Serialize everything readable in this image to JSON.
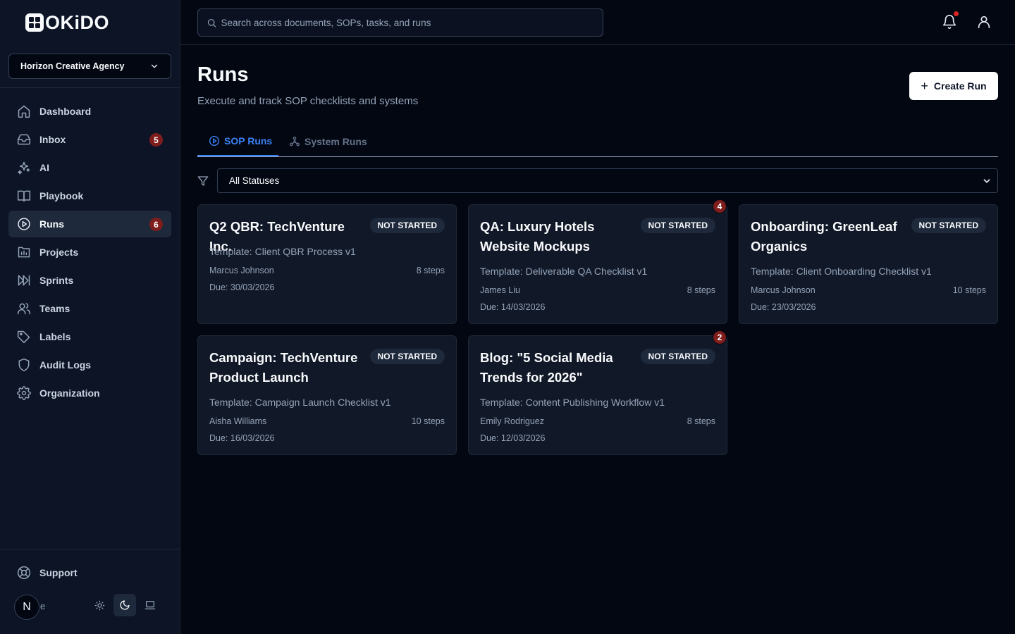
{
  "brand": {
    "name": "OKiDO"
  },
  "org": {
    "name": "Horizon Creative Agency"
  },
  "nav": {
    "items": [
      {
        "label": "Dashboard",
        "icon": "home-icon"
      },
      {
        "label": "Inbox",
        "icon": "inbox-icon",
        "badge": "5"
      },
      {
        "label": "AI",
        "icon": "sparkles-icon"
      },
      {
        "label": "Playbook",
        "icon": "book-icon"
      },
      {
        "label": "Runs",
        "icon": "play-circle-icon",
        "badge": "6",
        "active": true
      },
      {
        "label": "Projects",
        "icon": "chart-folder-icon"
      },
      {
        "label": "Sprints",
        "icon": "sprint-icon"
      },
      {
        "label": "Teams",
        "icon": "users-icon"
      },
      {
        "label": "Labels",
        "icon": "tag-icon"
      },
      {
        "label": "Audit Logs",
        "icon": "shield-icon"
      },
      {
        "label": "Organization",
        "icon": "gear-icon"
      }
    ],
    "support_label": "Support"
  },
  "user": {
    "initial": "N",
    "partial_text": "e"
  },
  "search": {
    "placeholder": "Search across documents, SOPs, tasks, and runs"
  },
  "page": {
    "title": "Runs",
    "subtitle": "Execute and track SOP checklists and systems",
    "create_label": "Create Run"
  },
  "tabs": [
    {
      "label": "SOP Runs",
      "active": true
    },
    {
      "label": "System Runs",
      "active": false
    }
  ],
  "filter": {
    "selected": "All Statuses"
  },
  "runs": [
    {
      "title": "Q2 QBR: TechVenture Inc.",
      "status": "NOT STARTED",
      "template": "Template: Client QBR Process v1",
      "assignee": "Marcus Johnson",
      "steps": "8 steps",
      "due": "Due: 30/03/2026"
    },
    {
      "title": "QA: Luxury Hotels Website Mockups",
      "status": "NOT STARTED",
      "template": "Template: Deliverable QA Checklist v1",
      "assignee": "James Liu",
      "steps": "8 steps",
      "due": "Due: 14/03/2026",
      "badge": "4"
    },
    {
      "title": "Onboarding: GreenLeaf Organics",
      "status": "NOT STARTED",
      "template": "Template: Client Onboarding Checklist v1",
      "assignee": "Marcus Johnson",
      "steps": "10 steps",
      "due": "Due: 23/03/2026"
    },
    {
      "title": "Campaign: TechVenture Product Launch",
      "status": "NOT STARTED",
      "template": "Template: Campaign Launch Checklist v1",
      "assignee": "Aisha Williams",
      "steps": "10 steps",
      "due": "Due: 16/03/2026"
    },
    {
      "title": "Blog: \"5 Social Media Trends for 2026\"",
      "status": "NOT STARTED",
      "template": "Template: Content Publishing Workflow v1",
      "assignee": "Emily Rodriguez",
      "steps": "8 steps",
      "due": "Due: 12/03/2026",
      "badge": "2"
    }
  ],
  "colors": {
    "background": "#030712",
    "sidebar": "#0c1426",
    "card": "#111827",
    "accent": "#3b82f6",
    "badge": "#7f1d1d",
    "notification_dot": "#dc2626"
  }
}
